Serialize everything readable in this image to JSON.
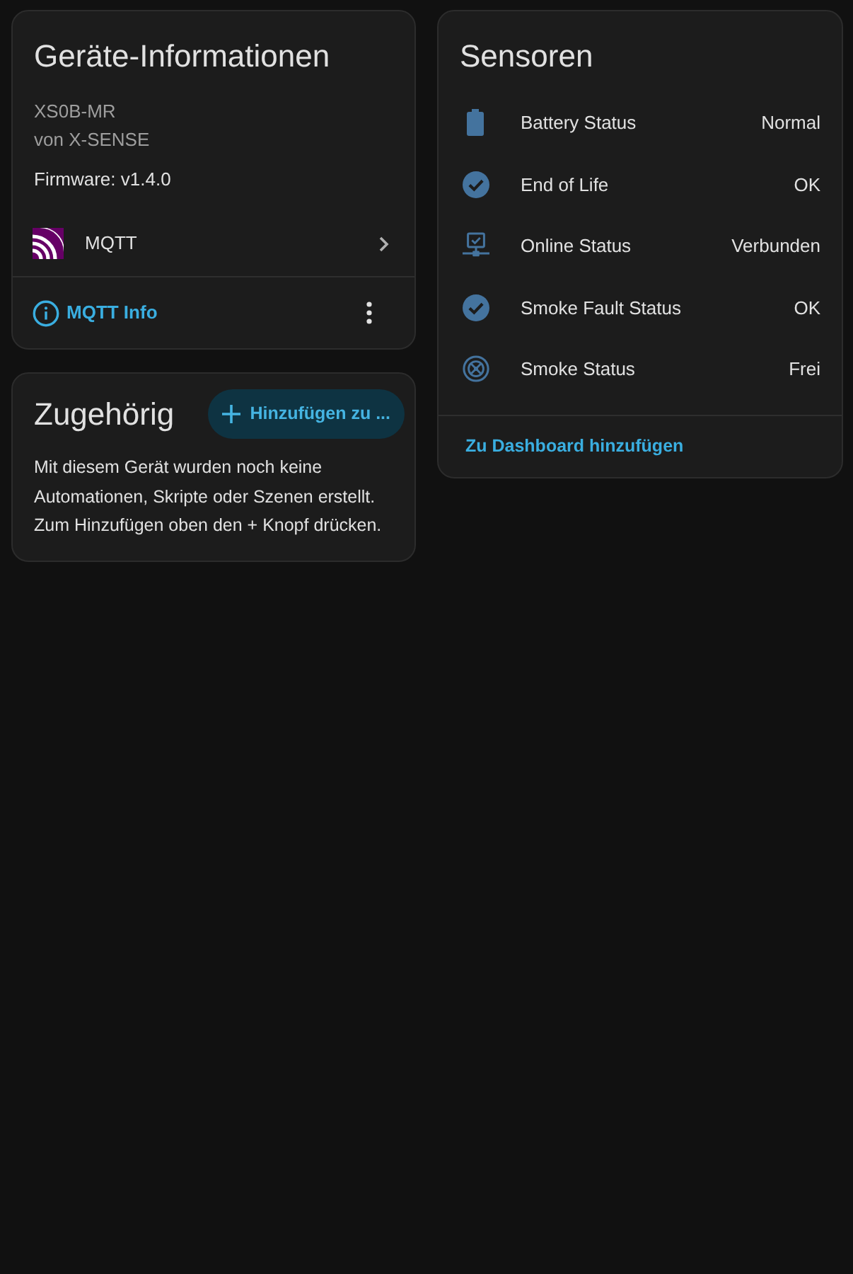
{
  "device_info": {
    "title": "Geräte-Informationen",
    "model": "XS0B-MR",
    "manufacturer": "von X-SENSE",
    "firmware": "Firmware: v1.4.0",
    "integration": "MQTT",
    "footer_link": "MQTT Info"
  },
  "related": {
    "title": "Zugehörig",
    "add_button": "Hinzufügen zu ...",
    "message": "Mit diesem Gerät wurden noch keine Automationen, Skripte oder Szenen erstellt. Zum Hinzufügen oben den + Knopf drücken."
  },
  "sensors": {
    "title": "Sensoren",
    "items": [
      {
        "kind": "battery",
        "name": "Battery Status",
        "state": "Normal"
      },
      {
        "kind": "check",
        "name": "End of Life",
        "state": "OK"
      },
      {
        "kind": "network",
        "name": "Online Status",
        "state": "Verbunden"
      },
      {
        "kind": "check",
        "name": "Smoke Fault Status",
        "state": "OK"
      },
      {
        "kind": "smoke",
        "name": "Smoke Status",
        "state": "Frei"
      }
    ],
    "footer_link": "Zu Dashboard hinzufügen"
  }
}
